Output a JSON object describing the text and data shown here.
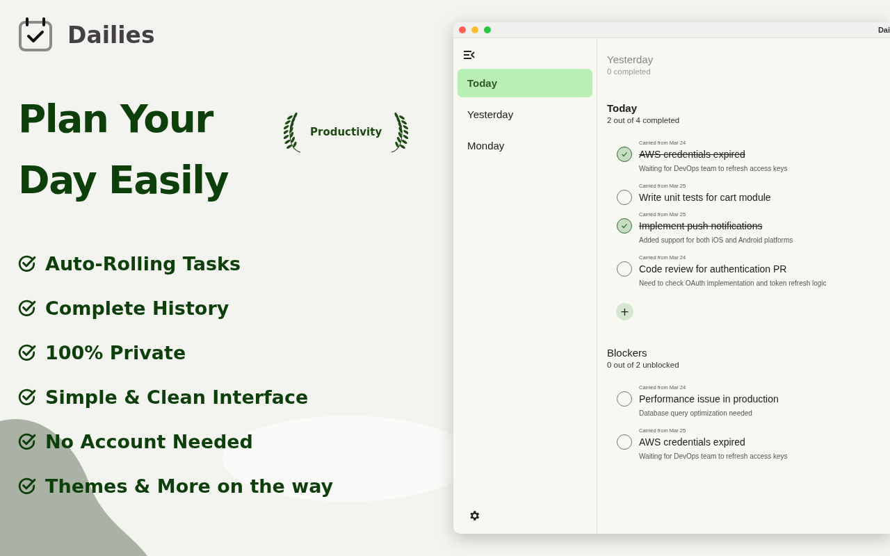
{
  "brand": {
    "name": "Dailies"
  },
  "headline": [
    "Plan Your",
    "Day Easily"
  ],
  "badge": {
    "label": "Productivity"
  },
  "features": [
    "Auto-Rolling Tasks",
    "Complete History",
    "100% Private",
    "Simple & Clean Interface",
    "No Account Needed",
    "Themes & More on the way"
  ],
  "window": {
    "title": "Dai"
  },
  "sidebar": {
    "items": [
      {
        "label": "Today",
        "selected": true
      },
      {
        "label": "Yesterday",
        "selected": false
      },
      {
        "label": "Monday",
        "selected": false
      }
    ]
  },
  "sections": [
    {
      "title": "Yesterday",
      "subtitle": "0 completed",
      "dimmed": true
    },
    {
      "title": "Today",
      "subtitle": "2 out of 4 completed",
      "dimmed": false,
      "add_button": "+",
      "tasks": [
        {
          "carried": "Carried from Mar 24",
          "title": "AWS credentials expired",
          "note": "Waiting for DevOps team to refresh access keys",
          "done": true
        },
        {
          "carried": "Carried from Mar 25",
          "title": "Write unit tests for cart module",
          "done": false
        },
        {
          "carried": "Carried from Mar 25",
          "title": "Implement push notifications",
          "note": "Added support for both iOS and Android platforms",
          "done": true
        },
        {
          "carried": "Carried from Mar 24",
          "title": "Code review for authentication PR",
          "note": "Need to check OAuth implementation and token refresh logic",
          "done": false
        }
      ]
    },
    {
      "title": "Blockers",
      "subtitle": "0 out of 2 unblocked",
      "dimmed": false,
      "tasks": [
        {
          "carried": "Carried from Mar 24",
          "title": "Performance issue in production",
          "note": "Database query optimization needed",
          "done": false
        },
        {
          "carried": "Carried from Mar 25",
          "title": "AWS credentials expired",
          "note": "Waiting for DevOps team to refresh access keys",
          "done": false
        }
      ]
    }
  ]
}
